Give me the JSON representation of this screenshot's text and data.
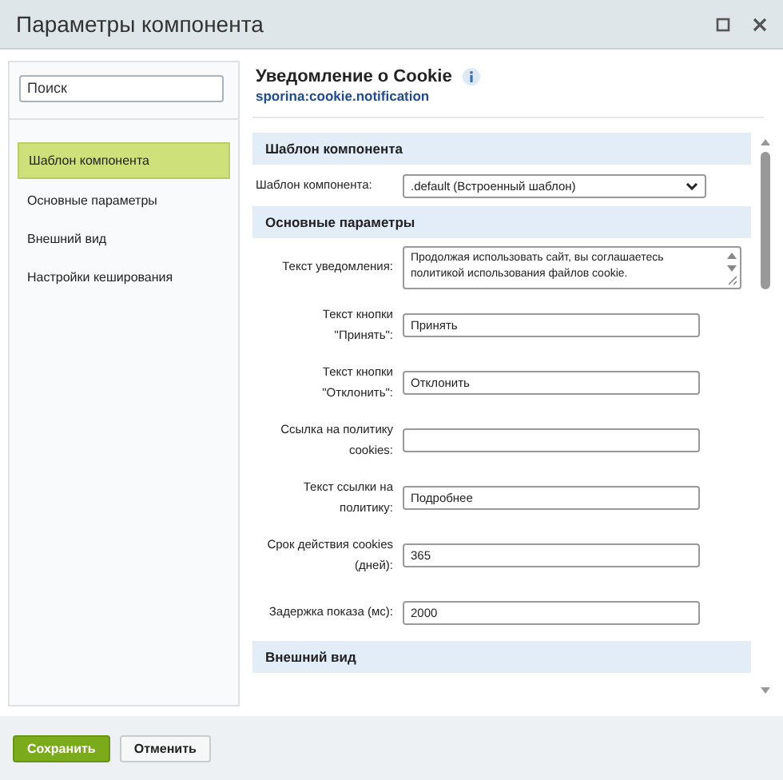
{
  "window": {
    "title": "Параметры компонента"
  },
  "sidebar": {
    "search": {
      "placeholder": "Поиск"
    },
    "items": [
      {
        "label": "Шаблон компонента",
        "selected": true
      },
      {
        "label": "Основные параметры",
        "selected": false
      },
      {
        "label": "Внешний вид",
        "selected": false
      },
      {
        "label": "Настройки кеширования",
        "selected": false
      }
    ]
  },
  "component": {
    "title": "Уведомление о Cookie",
    "code": "sporina:cookie.notification"
  },
  "sections": [
    {
      "title": "Шаблон компонента",
      "fields": [
        {
          "kind": "select",
          "label": "Шаблон компонента:",
          "value": ".default (Встроенный шаблон)"
        }
      ]
    },
    {
      "title": "Основные параметры",
      "fields": [
        {
          "kind": "textarea",
          "label": "Текст уведомления:",
          "value": "Продолжая использовать сайт, вы соглашаетесь политикой использования файлов cookie."
        },
        {
          "kind": "input",
          "label": "Текст кнопки \"Принять\":",
          "value": "Принять"
        },
        {
          "kind": "input",
          "label": "Текст кнопки \"Отклонить\":",
          "value": "Отклонить"
        },
        {
          "kind": "input",
          "label": "Ссылка на политику cookies:"
        },
        {
          "kind": "input",
          "label": "Текст ссылки на политику:",
          "value": "Подробнее"
        },
        {
          "kind": "input",
          "label": "Срок действия cookies (дней):",
          "value": "365"
        },
        {
          "kind": "input",
          "label": "Задержка показа (мс):",
          "value": "2000"
        }
      ]
    },
    {
      "title": "Внешний вид"
    }
  ],
  "buttons": [
    {
      "kind": "primary",
      "label": "Сохранить"
    },
    {
      "kind": "secondary",
      "label": "Отменить"
    }
  ]
}
